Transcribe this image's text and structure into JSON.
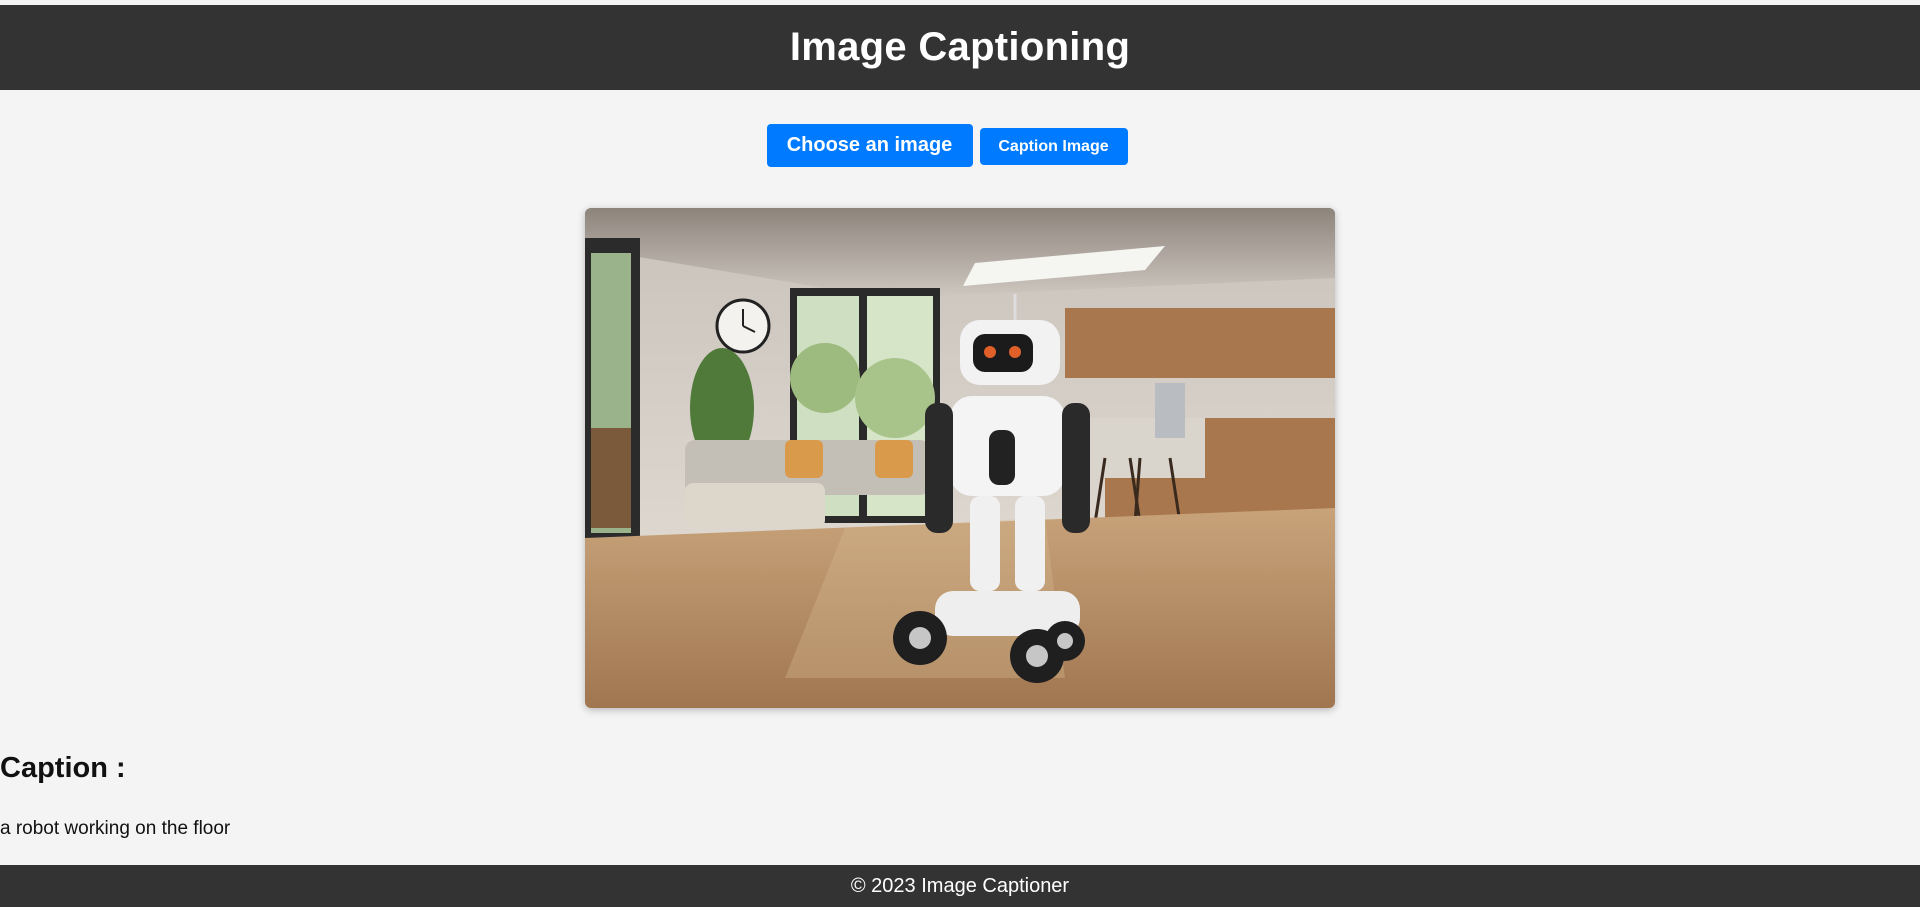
{
  "header": {
    "title": "Image Captioning"
  },
  "controls": {
    "choose_label": "Choose an image",
    "caption_label": "Caption Image"
  },
  "preview": {
    "image_icon": "uploaded-image"
  },
  "caption": {
    "heading": "Caption :",
    "text": "a robot working on the floor"
  },
  "footer": {
    "text": "© 2023 Image Captioner"
  },
  "colors": {
    "header_bg": "#333333",
    "button_bg": "#007bff",
    "page_bg": "#f4f4f4"
  }
}
